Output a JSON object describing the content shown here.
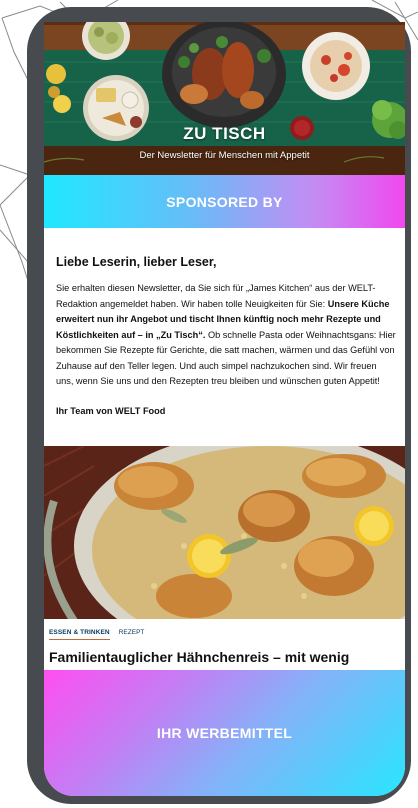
{
  "header": {
    "title": "ZU TISCH",
    "subtitle": "Der Newsletter für Menschen mit Appetit"
  },
  "sponsor": {
    "label": "SPONSORED BY"
  },
  "letter": {
    "greeting": "Liebe Leserin, lieber Leser,",
    "p1": "Sie erhalten diesen Newsletter, da Sie sich für „James Kitchen“ aus der WELT-Redaktion angemeldet haben. Wir haben tolle Neuigkeiten für Sie: ",
    "p1_bold": "Unsere Küche erweitert nun ihr Angebot und tischt Ihnen künftig noch mehr Rezepte und Köstlichkeiten auf – in „Zu Tisch“.",
    "p1_rest": " Ob schnelle Pasta oder Weihnachtsgans: Hier bekommen Sie Rezepte für Gerichte, die satt machen, wärmen und das Gefühl von Zuhause auf den Teller legen. Und auch simpel nachzukochen sind. Wir freuen uns, wenn Sie uns und den Rezepten treu bleiben und wünschen guten Appetit!",
    "signoff": "Ihr Team von WELT Food"
  },
  "article": {
    "category": "ESSEN & TRINKEN",
    "type": "REZEPT",
    "headline": "Familientauglicher Hähnchenreis – mit wenig"
  },
  "ad": {
    "label": "IHR WERBEMITTEL"
  },
  "colors": {
    "phone_frame": "#474b4f",
    "sponsor_gradient_start": "#1fe8ff",
    "sponsor_gradient_end": "#f048ef",
    "ad_gradient_start": "#ff4ef1",
    "ad_gradient_end": "#28e6ff",
    "tag_text": "#0b3b60",
    "tag_underline": "#c06a3c"
  }
}
